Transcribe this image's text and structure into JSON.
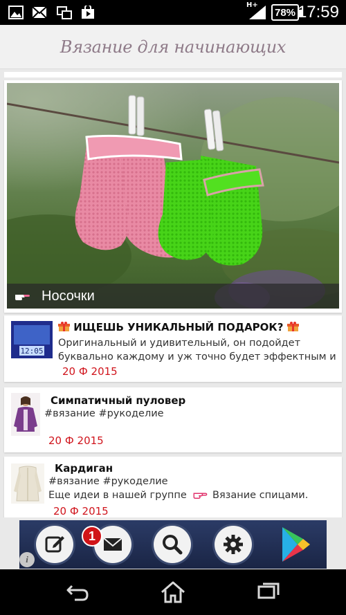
{
  "status_bar": {
    "battery": "78%",
    "time": "17:59",
    "network": "H+"
  },
  "app": {
    "title": "Вязание для начинающих"
  },
  "hero": {
    "caption": "Носочки"
  },
  "items": [
    {
      "title": "ИЩЕШЬ УНИКАЛЬНЫЙ ПОДАРОК?",
      "desc_line1": "Оригинальный и удивительный, он подойдет",
      "desc_line2": "буквально каждому и уж точно будет эффектным и...",
      "date": "20 Ф 2015",
      "thumb_text": "12:05"
    },
    {
      "title": "Симпатичный пуловер",
      "tags": "#вязание #рукоделие",
      "date": "20 Ф 2015"
    },
    {
      "title": "Кардиган",
      "tags": "#вязание #рукоделие",
      "extra_prefix": "Еще идеи в нашей группе",
      "extra_link": "Вязание спицами.",
      "date": "20 Ф 2015"
    }
  ],
  "ad": {
    "badge_count": "1",
    "info_label": "i"
  },
  "colors": {
    "date_red": "#d0141c",
    "title_mauve": "#8e7a88",
    "ad_background": "#223055"
  }
}
